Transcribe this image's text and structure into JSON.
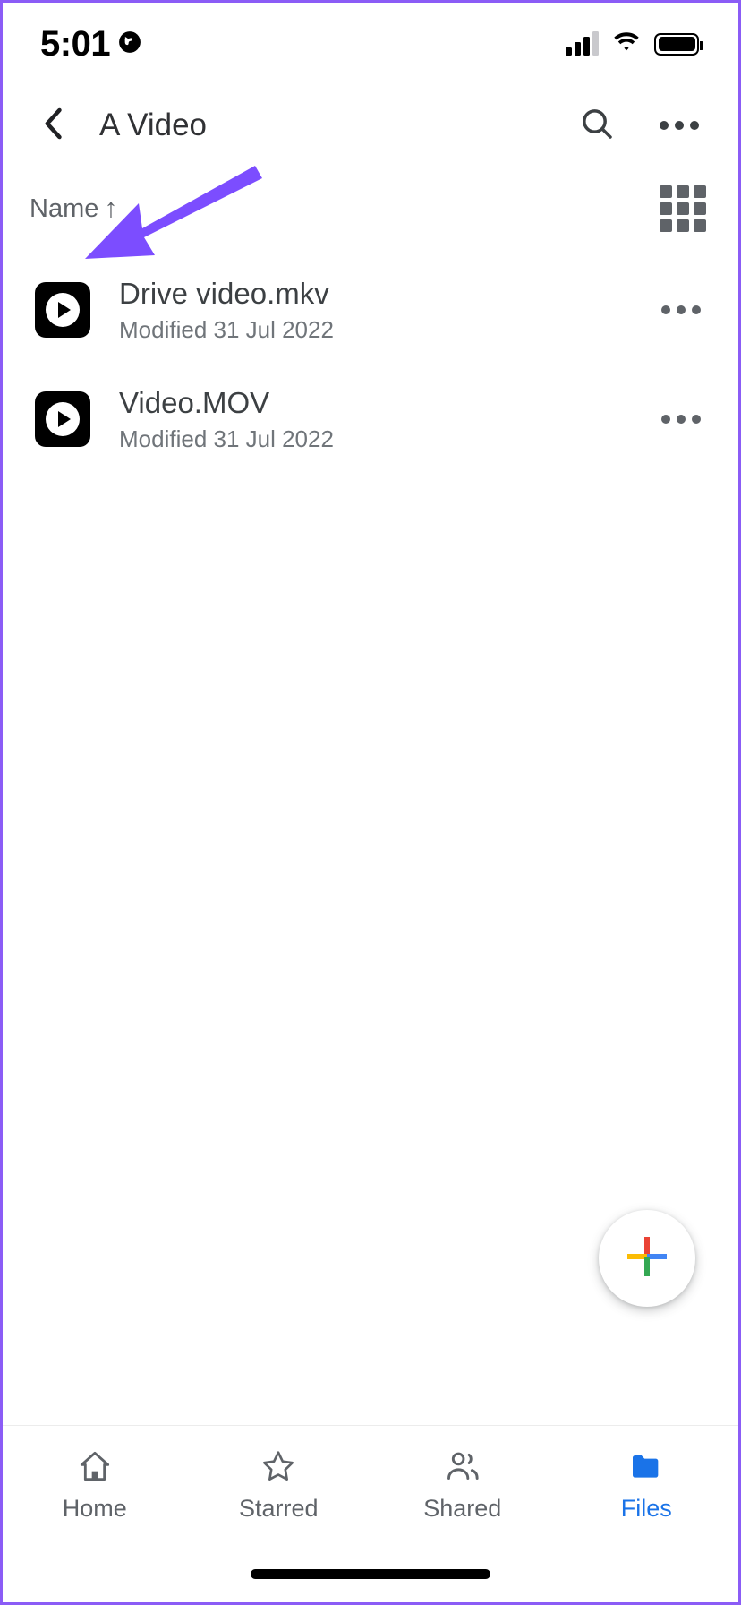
{
  "status_bar": {
    "time": "5:01",
    "location_icon": "globe-icon",
    "cellular_icon": "cellular-signal-icon",
    "cellular_bars_filled": 3,
    "cellular_bars_total": 4,
    "wifi_icon": "wifi-icon",
    "battery_icon": "battery-full-icon"
  },
  "app_bar": {
    "back_icon": "back-chevron-icon",
    "title": "A Video",
    "search_icon": "search-icon",
    "overflow_icon": "more-options-icon"
  },
  "sort_row": {
    "sort_label": "Name",
    "sort_direction_icon": "arrow-up-icon",
    "sort_direction_glyph": "↑",
    "view_toggle_icon": "grid-view-icon"
  },
  "annotation": {
    "arrow_icon": "annotation-arrow-icon",
    "color": "#7c4dff"
  },
  "files": [
    {
      "name": "Drive video.mkv",
      "modified": "Modified 31 Jul 2022",
      "thumbnail_icon": "video-play-icon",
      "menu_icon": "more-options-icon"
    },
    {
      "name": "Video.MOV",
      "modified": "Modified 31 Jul 2022",
      "thumbnail_icon": "video-play-icon",
      "menu_icon": "more-options-icon"
    }
  ],
  "fab": {
    "icon": "plus-icon",
    "colors": {
      "red": "#ea4335",
      "yellow": "#fbbc04",
      "blue": "#4285f4",
      "green": "#34a853"
    }
  },
  "bottom_nav": {
    "active_color": "#1a73e8",
    "inactive_color": "#5f6368",
    "items": [
      {
        "label": "Home",
        "icon": "home-icon",
        "active": false
      },
      {
        "label": "Starred",
        "icon": "star-icon",
        "active": false
      },
      {
        "label": "Shared",
        "icon": "people-icon",
        "active": false
      },
      {
        "label": "Files",
        "icon": "folder-icon",
        "active": true
      }
    ]
  }
}
